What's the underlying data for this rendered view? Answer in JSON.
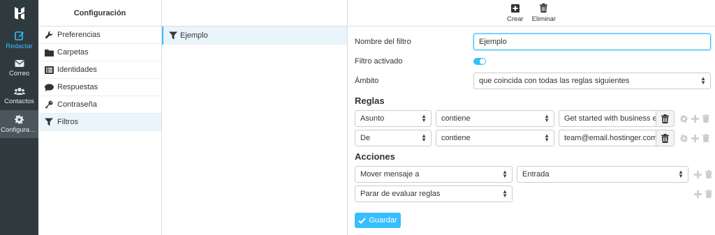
{
  "nav": {
    "items": [
      {
        "label": "Redactar",
        "icon": "compose-icon"
      },
      {
        "label": "Correo",
        "icon": "envelope-icon"
      },
      {
        "label": "Contactos",
        "icon": "users-icon"
      },
      {
        "label": "Configuraci…",
        "icon": "gear-icon"
      }
    ]
  },
  "settings": {
    "title": "Configuración",
    "items": [
      {
        "label": "Preferencias",
        "icon": "wrench-icon"
      },
      {
        "label": "Carpetas",
        "icon": "folder-icon"
      },
      {
        "label": "Identidades",
        "icon": "id-card-icon"
      },
      {
        "label": "Respuestas",
        "icon": "comment-icon"
      },
      {
        "label": "Contraseña",
        "icon": "key-icon"
      },
      {
        "label": "Filtros",
        "icon": "filter-icon"
      }
    ]
  },
  "filters": {
    "items": [
      {
        "label": "Ejemplo",
        "icon": "filter-icon"
      }
    ]
  },
  "toolbar": {
    "create_label": "Crear",
    "delete_label": "Eliminar"
  },
  "form": {
    "name_label": "Nombre del filtro",
    "name_value": "Ejemplo",
    "enabled_label": "Filtro activado",
    "enabled": true,
    "scope_label": "Ámbito",
    "scope_value": "que coincida con todas las reglas siguientes",
    "rules_title": "Reglas",
    "rules": [
      {
        "header": "Asunto",
        "op": "contiene",
        "value": "Get started with business ema"
      },
      {
        "header": "De",
        "op": "contiene",
        "value": "team@email.hostinger.com"
      }
    ],
    "actions_title": "Acciones",
    "actions": [
      {
        "action": "Mover mensaje a",
        "target": "Entrada"
      },
      {
        "action": "Parar de evaluar reglas",
        "target": ""
      }
    ],
    "save_label": "Guardar"
  },
  "colors": {
    "accent": "#37beff",
    "rail": "#2f3a3f",
    "rail_active": "#4a565c"
  }
}
